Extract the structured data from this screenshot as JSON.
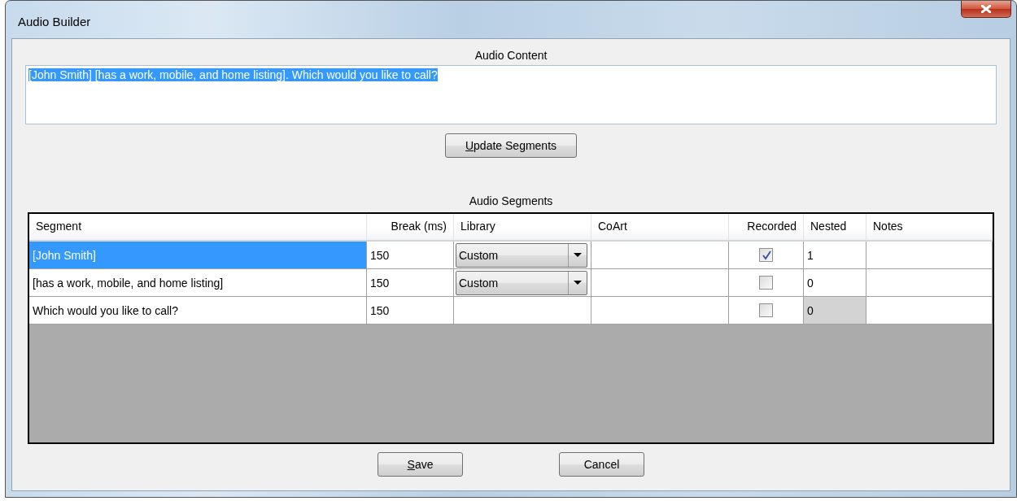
{
  "window": {
    "title": "Audio Builder"
  },
  "audio_content": {
    "label": "Audio Content",
    "value": "[John Smith] [has a work, mobile, and home listing].  Which would you like to call?",
    "selected_all": true
  },
  "update_button": {
    "label": "Update Segments",
    "access_key_underlined": true
  },
  "segments": {
    "label": "Audio Segments",
    "columns": [
      "Segment",
      "Break (ms)",
      "Library",
      "CoArt",
      "Recorded",
      "Nested",
      "Notes"
    ],
    "rows": [
      {
        "selected": true,
        "segment": "[John Smith]",
        "break": "150",
        "library": "Custom",
        "recorded": true,
        "nested": "1",
        "nested_disabled": false
      },
      {
        "selected": false,
        "segment": "[has a work, mobile, and home listing]",
        "break": "150",
        "library": "Custom",
        "recorded": false,
        "nested": "0",
        "nested_disabled": false
      },
      {
        "selected": false,
        "segment": "Which would you like to call?",
        "break": "150",
        "recorded": false,
        "nested": "0",
        "nested_disabled": true
      }
    ]
  },
  "buttons": [
    {
      "label": "Save",
      "access_key_underlined": true
    },
    {
      "label": "Cancel",
      "access_key_underlined": false
    }
  ]
}
